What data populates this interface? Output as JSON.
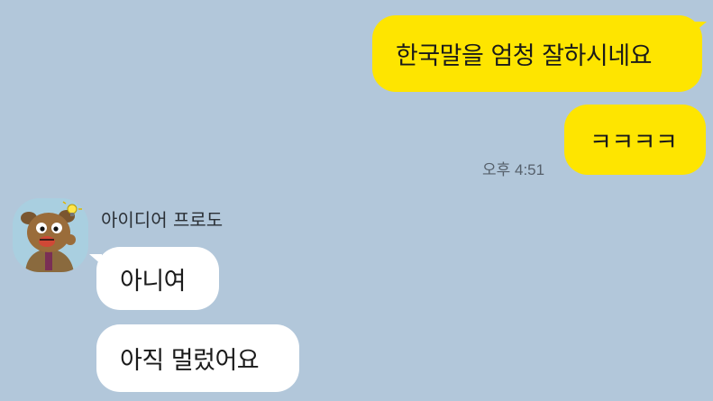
{
  "chat": {
    "outgoing": [
      {
        "text": "한국말을 엄청 잘하시네요"
      },
      {
        "text": "ㅋㅋㅋㅋ"
      }
    ],
    "outgoing_time": "오후 4:51",
    "sender": {
      "name": "아이디어 프로도",
      "avatar_icon": "frodo-character-avatar-icon"
    },
    "incoming": [
      {
        "text": "아니여"
      },
      {
        "text": "아직 멀렀어요"
      }
    ],
    "colors": {
      "background": "#b2c7da",
      "outgoing_bubble": "#fee500",
      "incoming_bubble": "#ffffff"
    }
  }
}
